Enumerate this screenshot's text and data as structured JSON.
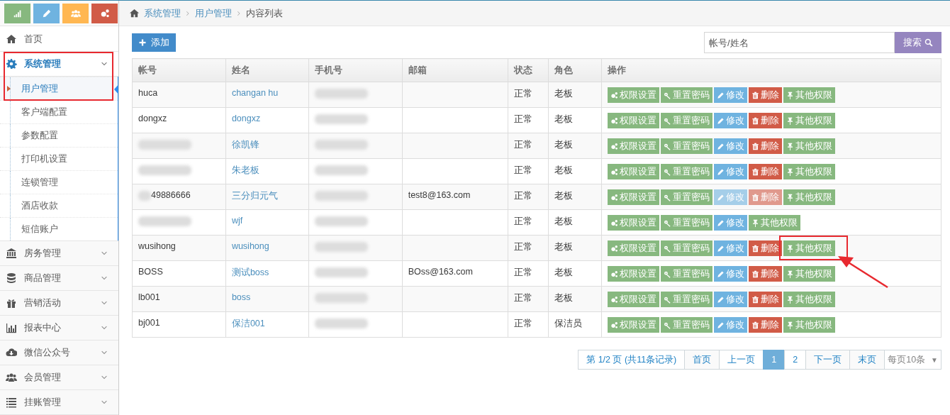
{
  "shortcuts": [
    {
      "color": "#87b87f"
    },
    {
      "color": "#6fb3e0"
    },
    {
      "color": "#ffb752"
    },
    {
      "color": "#d15b47"
    }
  ],
  "sidebar": {
    "items": [
      {
        "label": "首页"
      },
      {
        "label": "系统管理",
        "expanded": true,
        "selected": true,
        "highlighted": true,
        "children": [
          {
            "label": "用户管理",
            "selected": true
          },
          {
            "label": "客户端配置",
            "selected": false
          },
          {
            "label": "参数配置",
            "selected": false
          },
          {
            "label": "打印机设置",
            "selected": false
          },
          {
            "label": "连锁管理",
            "selected": false
          },
          {
            "label": "酒店收款",
            "selected": false
          },
          {
            "label": "短信账户",
            "selected": false
          }
        ]
      },
      {
        "label": "房务管理",
        "expanded": false,
        "selected": false
      },
      {
        "label": "商品管理",
        "expanded": false,
        "selected": false
      },
      {
        "label": "营销活动",
        "expanded": false,
        "selected": false
      },
      {
        "label": "报表中心",
        "expanded": false,
        "selected": false
      },
      {
        "label": "微信公众号",
        "expanded": false,
        "selected": false
      },
      {
        "label": "会员管理",
        "expanded": false,
        "selected": false
      },
      {
        "label": "挂账管理",
        "expanded": false,
        "selected": false
      }
    ]
  },
  "breadcrumb": [
    "系统管理",
    "用户管理",
    "内容列表"
  ],
  "toolbar": {
    "add_button": "添加",
    "search": {
      "placeholder": "帐号/姓名",
      "button": "搜索"
    }
  },
  "table": {
    "columns": [
      "帐号",
      "姓名",
      "手机号",
      "邮箱",
      "状态",
      "角色",
      "操作"
    ],
    "rows": [
      {
        "account": "huca",
        "account_blurred": false,
        "name": "changan hu",
        "phone_blurred": true,
        "status": "正常",
        "role": "老板",
        "actions": [
          {
            "kind": "permissions",
            "label": "权限设置",
            "disabled": false
          },
          {
            "kind": "reset",
            "label": "重置密码",
            "disabled": false
          },
          {
            "kind": "edit",
            "label": "修改",
            "disabled": false
          },
          {
            "kind": "delete",
            "label": "删除",
            "disabled": false
          },
          {
            "kind": "other",
            "label": "其他权限",
            "disabled": false,
            "highlighted": false
          }
        ]
      },
      {
        "account": "dongxz",
        "account_blurred": false,
        "name": "dongxz",
        "phone_blurred": true,
        "status": "正常",
        "role": "老板",
        "actions": [
          {
            "kind": "permissions",
            "label": "权限设置",
            "disabled": false
          },
          {
            "kind": "reset",
            "label": "重置密码",
            "disabled": false
          },
          {
            "kind": "edit",
            "label": "修改",
            "disabled": false
          },
          {
            "kind": "delete",
            "label": "删除",
            "disabled": false
          },
          {
            "kind": "other",
            "label": "其他权限",
            "disabled": false,
            "highlighted": false
          }
        ]
      },
      {
        "account_blurred": true,
        "name": "徐凯锋",
        "phone_blurred": true,
        "status": "正常",
        "role": "老板",
        "actions": [
          {
            "kind": "permissions",
            "label": "权限设置",
            "disabled": false
          },
          {
            "kind": "reset",
            "label": "重置密码",
            "disabled": false
          },
          {
            "kind": "edit",
            "label": "修改",
            "disabled": false
          },
          {
            "kind": "delete",
            "label": "删除",
            "disabled": false
          },
          {
            "kind": "other",
            "label": "其他权限",
            "disabled": false,
            "highlighted": false
          }
        ]
      },
      {
        "account_blurred": true,
        "name": "朱老板",
        "phone_blurred": true,
        "status": "正常",
        "role": "老板",
        "actions": [
          {
            "kind": "permissions",
            "label": "权限设置",
            "disabled": false
          },
          {
            "kind": "reset",
            "label": "重置密码",
            "disabled": false
          },
          {
            "kind": "edit",
            "label": "修改",
            "disabled": false
          },
          {
            "kind": "delete",
            "label": "删除",
            "disabled": false
          },
          {
            "kind": "other",
            "label": "其他权限",
            "disabled": false,
            "highlighted": false
          }
        ]
      },
      {
        "account": "49886666",
        "account_blurred": true,
        "name": "三分归元气",
        "phone_blurred": true,
        "email": "test8@163.com",
        "status": "正常",
        "role": "老板",
        "actions": [
          {
            "kind": "permissions",
            "label": "权限设置",
            "disabled": false
          },
          {
            "kind": "reset",
            "label": "重置密码",
            "disabled": false
          },
          {
            "kind": "edit",
            "label": "修改",
            "disabled": true
          },
          {
            "kind": "delete",
            "label": "删除",
            "disabled": true
          },
          {
            "kind": "other",
            "label": "其他权限",
            "disabled": false,
            "highlighted": false
          }
        ]
      },
      {
        "account_blurred": true,
        "name": "wjf",
        "phone_blurred": true,
        "status": "正常",
        "role": "老板",
        "actions": [
          {
            "kind": "permissions",
            "label": "权限设置",
            "disabled": false
          },
          {
            "kind": "reset",
            "label": "重置密码",
            "disabled": false
          },
          {
            "kind": "edit",
            "label": "修改",
            "disabled": false
          },
          {
            "kind": "other",
            "label": "其他权限",
            "disabled": false,
            "highlighted": false
          }
        ]
      },
      {
        "account": "wusihong",
        "account_blurred": false,
        "name": "wusihong",
        "phone_blurred": true,
        "status": "正常",
        "role": "老板",
        "actions": [
          {
            "kind": "permissions",
            "label": "权限设置",
            "disabled": false
          },
          {
            "kind": "reset",
            "label": "重置密码",
            "disabled": false
          },
          {
            "kind": "edit",
            "label": "修改",
            "disabled": false
          },
          {
            "kind": "delete",
            "label": "删除",
            "disabled": false
          },
          {
            "kind": "other",
            "label": "其他权限",
            "disabled": false,
            "highlighted": true
          }
        ]
      },
      {
        "account": "BOSS",
        "account_blurred": false,
        "name": "测试boss",
        "phone_blurred": true,
        "email": "BOss@163.com",
        "status": "正常",
        "role": "老板",
        "actions": [
          {
            "kind": "permissions",
            "label": "权限设置",
            "disabled": false
          },
          {
            "kind": "reset",
            "label": "重置密码",
            "disabled": false
          },
          {
            "kind": "edit",
            "label": "修改",
            "disabled": false
          },
          {
            "kind": "delete",
            "label": "删除",
            "disabled": false
          },
          {
            "kind": "other",
            "label": "其他权限",
            "disabled": false,
            "highlighted": false
          }
        ]
      },
      {
        "account": "lb001",
        "account_blurred": false,
        "name": "boss",
        "phone_blurred": true,
        "status": "正常",
        "role": "老板",
        "actions": [
          {
            "kind": "permissions",
            "label": "权限设置",
            "disabled": false
          },
          {
            "kind": "reset",
            "label": "重置密码",
            "disabled": false
          },
          {
            "kind": "edit",
            "label": "修改",
            "disabled": false
          },
          {
            "kind": "delete",
            "label": "删除",
            "disabled": false
          },
          {
            "kind": "other",
            "label": "其他权限",
            "disabled": false,
            "highlighted": false
          }
        ]
      },
      {
        "account": "bj001",
        "account_blurred": false,
        "name": "保洁001",
        "phone_blurred": true,
        "status": "正常",
        "role": "保洁员",
        "actions": [
          {
            "kind": "permissions",
            "label": "权限设置",
            "disabled": false
          },
          {
            "kind": "reset",
            "label": "重置密码",
            "disabled": false
          },
          {
            "kind": "edit",
            "label": "修改",
            "disabled": false
          },
          {
            "kind": "delete",
            "label": "删除",
            "disabled": false
          },
          {
            "kind": "other",
            "label": "其他权限",
            "disabled": false,
            "highlighted": false
          }
        ]
      }
    ]
  },
  "pagination": {
    "summary": "第 1/2 页 (共11条记录)",
    "first": "首页",
    "prev": "上一页",
    "pages": [
      {
        "label": "1",
        "selected": true
      },
      {
        "label": "2",
        "selected": false
      }
    ],
    "next": "下一页",
    "last": "末页",
    "page_size": "每页10条",
    "page_size_caret": "▼"
  }
}
